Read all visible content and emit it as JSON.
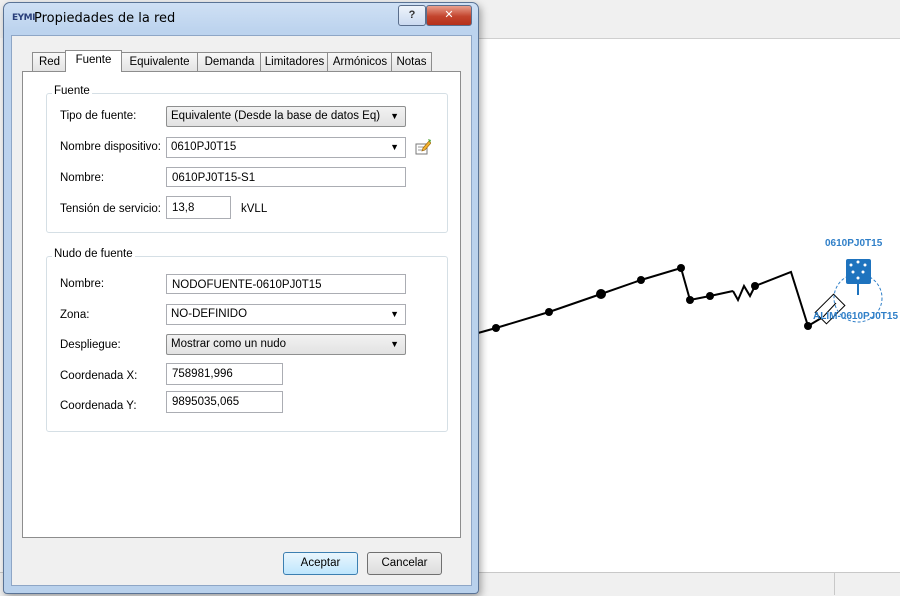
{
  "dialog": {
    "app_logo": "EYMI",
    "title": "Propiedades de la red",
    "help_label": "?",
    "close_label": "✕"
  },
  "tabs": [
    {
      "label": "Red"
    },
    {
      "label": "Fuente"
    },
    {
      "label": "Equivalente"
    },
    {
      "label": "Demanda"
    },
    {
      "label": "Limitadores"
    },
    {
      "label": "Armónicos"
    },
    {
      "label": "Notas"
    }
  ],
  "active_tab": "Fuente",
  "fuente_group": {
    "title": "Fuente",
    "tipo_fuente_label": "Tipo de fuente:",
    "tipo_fuente_value": "Equivalente (Desde la base de datos Eq)",
    "nombre_dispositivo_label": "Nombre dispositivo:",
    "nombre_dispositivo_value": "0610PJ0T15",
    "nombre_label": "Nombre:",
    "nombre_value": "0610PJ0T15-S1",
    "tension_label": "Tensión de servicio:",
    "tension_value": "13,8",
    "tension_unit": "kVLL"
  },
  "nudo_group": {
    "title": "Nudo de fuente",
    "nombre_label": "Nombre:",
    "nombre_value": "NODOFUENTE-0610PJ0T15",
    "zona_label": "Zona:",
    "zona_value": "NO-DEFINIDO",
    "despliegue_label": "Despliegue:",
    "despliegue_value": "Mostrar como un nudo",
    "coord_x_label": "Coordenada X:",
    "coord_x_value": "758981,996",
    "coord_y_label": "Coordenada Y:",
    "coord_y_value": "9895035,065"
  },
  "buttons": {
    "accept": "Aceptar",
    "cancel": "Cancelar"
  },
  "map": {
    "source_label": "0610PJ0T15",
    "feeder_label": "ALIM-0610PJ0T15",
    "accent_color": "#2f7fc8",
    "line_color": "#000000"
  }
}
